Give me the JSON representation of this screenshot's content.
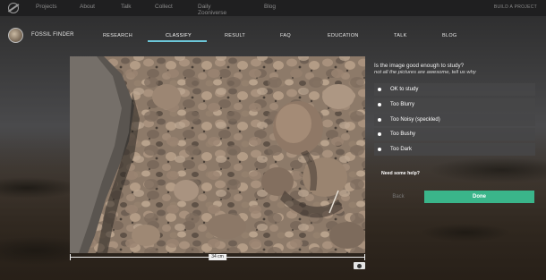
{
  "topbar": {
    "logo_icon": "zooniverse-logo-icon",
    "items": [
      "Projects",
      "About",
      "Talk",
      "Collect",
      "Daily Zooniverse",
      "Blog"
    ],
    "build_label": "BUILD A PROJECT"
  },
  "project": {
    "title": "FOSSIL FINDER",
    "nav": [
      "RESEARCH",
      "CLASSIFY",
      "RESULT",
      "FAQ",
      "EDUCATION",
      "TALK",
      "BLOG"
    ],
    "active_tab": "CLASSIFY",
    "accent_color": "#6cc6d8"
  },
  "subject": {
    "scale_label": "34 cm",
    "info_icon": "info-icon"
  },
  "task": {
    "question": "Is the image good enough to study?",
    "subtitle": "not all the pictures are awesome, tell us why",
    "answers": [
      "OK to study",
      "Too Blurry",
      "Too Noisy (speckled)",
      "Too Bushy",
      "Too Dark"
    ],
    "help_label": "Need some help?",
    "back_label": "Back",
    "done_label": "Done",
    "done_color": "#3ab58a"
  }
}
